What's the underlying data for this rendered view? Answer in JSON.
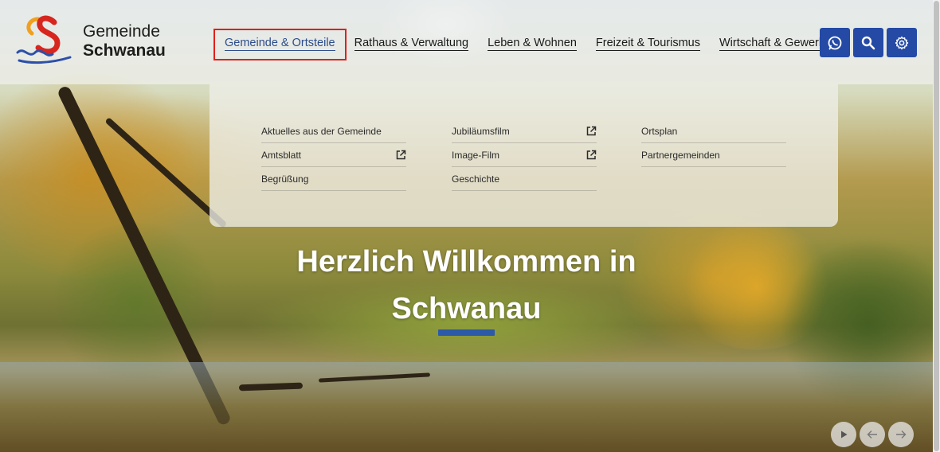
{
  "brand": {
    "line1": "Gemeinde",
    "line2": "Schwanau"
  },
  "nav": [
    {
      "label": "Gemeinde & Ortsteile",
      "active": true
    },
    {
      "label": "Rathaus & Verwaltung"
    },
    {
      "label": "Leben & Wohnen"
    },
    {
      "label": "Freizeit & Tourismus"
    },
    {
      "label": "Wirtschaft & Gewerbe"
    }
  ],
  "header_icons": [
    "whatsapp-icon",
    "search-icon",
    "settings-gear-icon"
  ],
  "dropdown": {
    "columns": [
      [
        {
          "label": "Aktuelles aus der Gemeinde",
          "external": false
        },
        {
          "label": "Amtsblatt",
          "external": true
        },
        {
          "label": "Begrüßung",
          "external": false
        }
      ],
      [
        {
          "label": "Jubiläumsfilm",
          "external": true
        },
        {
          "label": "Image-Film",
          "external": true
        },
        {
          "label": "Geschichte",
          "external": false
        }
      ],
      [
        {
          "label": "Ortsplan",
          "external": false
        },
        {
          "label": "Partnergemeinden",
          "external": false
        }
      ]
    ]
  },
  "hero": {
    "line1": "Herzlich Willkommen in",
    "line2": "Schwanau"
  },
  "slider_controls": [
    "play-icon",
    "arrow-left-icon",
    "arrow-right-icon"
  ],
  "colors": {
    "accent": "#244aa5",
    "active_outline": "#e0201c",
    "underline_bar": "#2c5aa8"
  }
}
